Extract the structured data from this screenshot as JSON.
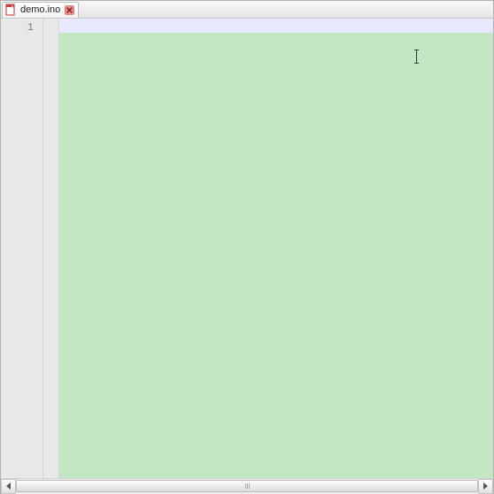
{
  "tab": {
    "filename": "demo.ino",
    "icon": "file-icon",
    "close_icon": "close-icon"
  },
  "editor": {
    "line_numbers": [
      "1"
    ],
    "content": "",
    "current_line_bg": "#e8e8ff",
    "background": "#c3e7c3"
  },
  "scrollbar": {
    "thumb_width_percent": 100
  }
}
